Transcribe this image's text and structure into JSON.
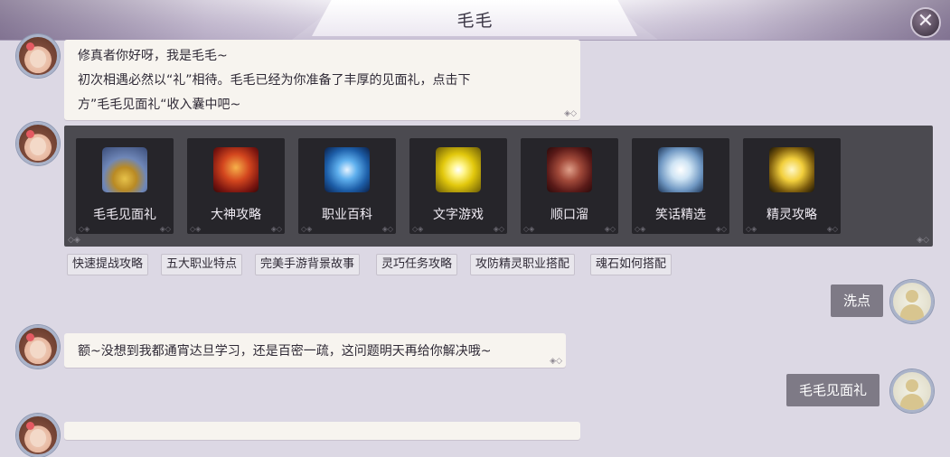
{
  "header": {
    "title": "毛毛",
    "close_icon": "close-icon"
  },
  "messages": {
    "greeting": {
      "lines": [
        "修真者你好呀，我是毛毛~",
        "初次相遇必然以“礼”相待。毛毛已经为你准备了丰厚的见面礼，点击下",
        "方”毛毛见面礼“收入囊中吧~"
      ]
    },
    "tiles": [
      {
        "label": "毛毛见面礼",
        "icon": "treasure-chest-icon"
      },
      {
        "label": "大神攻略",
        "icon": "fire-figure-icon"
      },
      {
        "label": "职业百科",
        "icon": "blue-wing-icon"
      },
      {
        "label": "文字游戏",
        "icon": "golden-burst-icon"
      },
      {
        "label": "顺口溜",
        "icon": "warrior-icon"
      },
      {
        "label": "笑话精选",
        "icon": "white-phoenix-icon"
      },
      {
        "label": "精灵攻略",
        "icon": "golden-spirit-icon"
      }
    ],
    "chips": [
      "快速提战攻略",
      "五大职业特点",
      "完美手游背景故事",
      "灵巧任务攻略",
      "攻防精灵职业搭配",
      "魂石如何搭配"
    ],
    "user_msg_1": "洗点",
    "reply_1": "额~没想到我都通宵达旦学习，还是百密一疏，这问题明天再给你解决哦~",
    "user_msg_2": "毛毛见面礼"
  },
  "colors": {
    "background": "#dcd8e4",
    "bubble": "#f7f4ef",
    "panel": "#4b4a50",
    "tile": "#26252a",
    "user_bubble": "#7e7a86"
  }
}
